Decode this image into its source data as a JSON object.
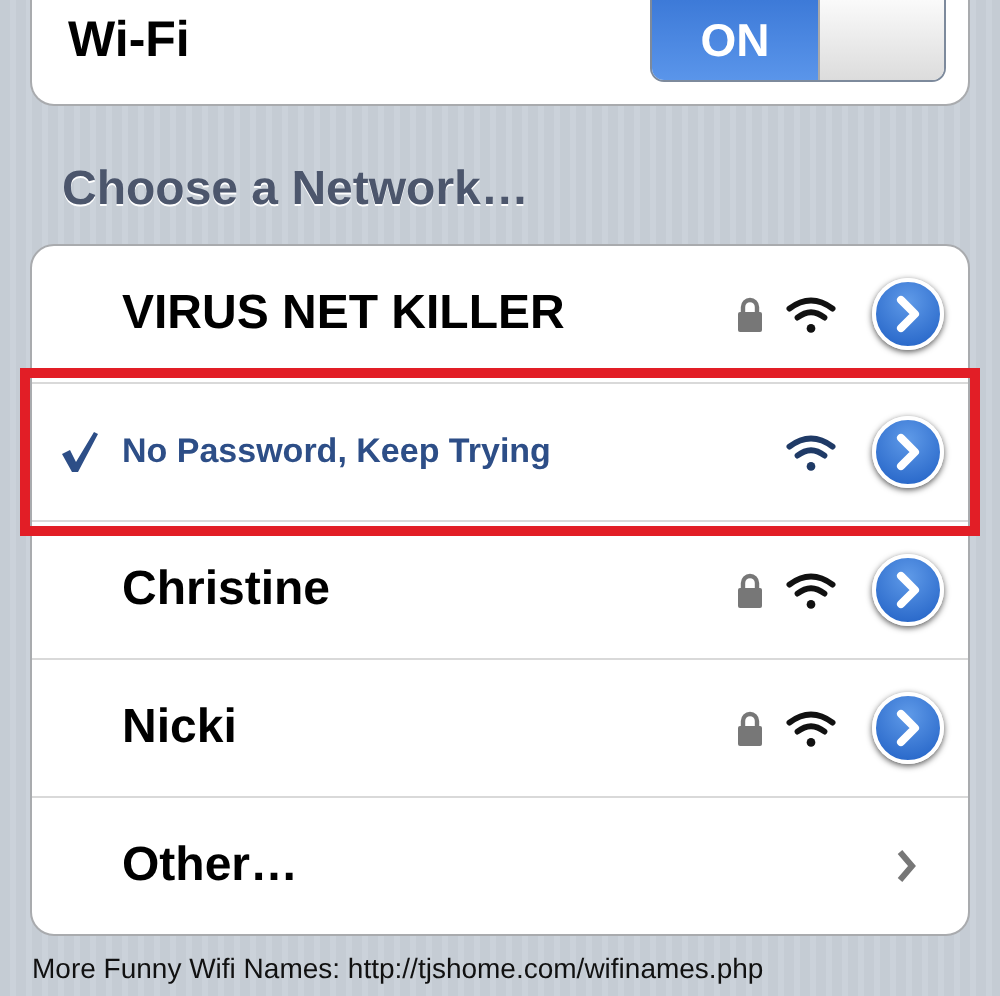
{
  "wifi": {
    "label": "Wi-Fi",
    "on": true,
    "toggle_text": "ON"
  },
  "section_header": "Choose a Network…",
  "networks": [
    {
      "kind": "network",
      "name": "VIRUS NET KILLER",
      "selected": false,
      "locked": true,
      "highlighted": false
    },
    {
      "kind": "network",
      "name": "No Password, Keep Trying",
      "selected": true,
      "locked": false,
      "highlighted": true
    },
    {
      "kind": "network",
      "name": "Christine",
      "selected": false,
      "locked": true,
      "highlighted": false
    },
    {
      "kind": "network",
      "name": "Nicki",
      "selected": false,
      "locked": true,
      "highlighted": false
    },
    {
      "kind": "other",
      "name": "Other…",
      "selected": false
    }
  ],
  "caption": "More Funny Wifi Names: http://tjshome.com/wifinames.php"
}
